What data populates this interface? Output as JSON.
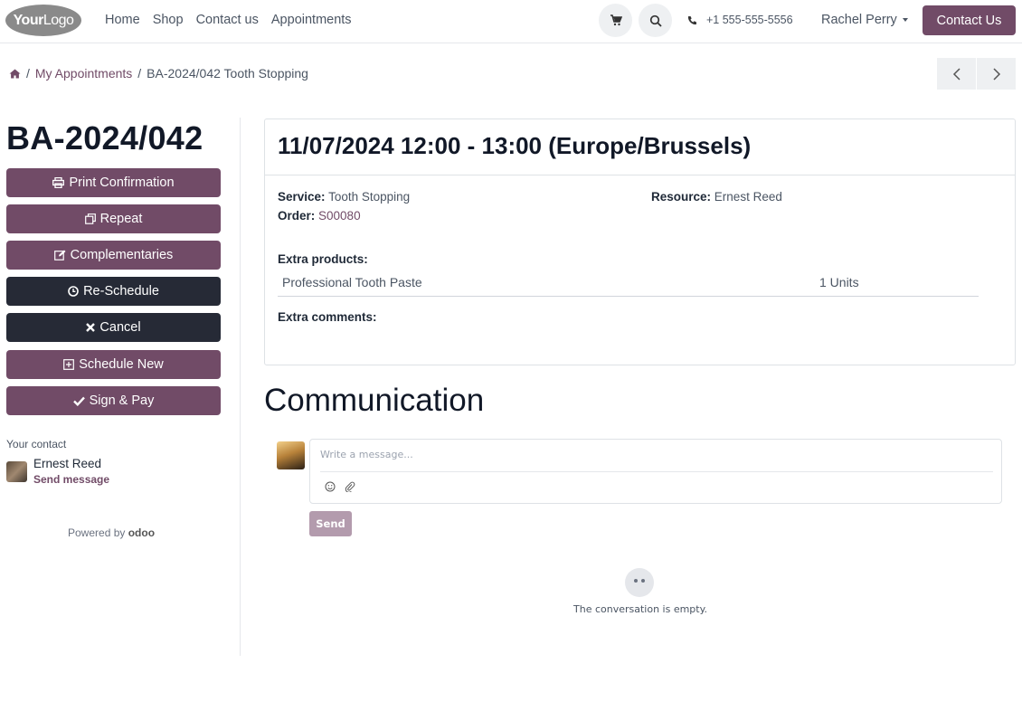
{
  "header": {
    "logo_text_bold": "Your",
    "logo_text_light": "Logo",
    "nav": [
      "Home",
      "Shop",
      "Contact us",
      "Appointments"
    ],
    "phone": "+1 555-555-5556",
    "user_name": "Rachel Perry",
    "contact_button": "Contact Us"
  },
  "breadcrumb": {
    "home_icon": "home-icon",
    "separator": "/",
    "items": [
      "My Appointments",
      "BA-2024/042 Tooth Stopping"
    ]
  },
  "sidebar": {
    "reference": "BA-2024/042",
    "buttons": [
      {
        "label": "Print Confirmation",
        "icon": "print-icon",
        "style": "purple"
      },
      {
        "label": "Repeat",
        "icon": "copy-icon",
        "style": "purple"
      },
      {
        "label": "Complementaries",
        "icon": "edit-icon",
        "style": "purple"
      },
      {
        "label": "Re-Schedule",
        "icon": "clock-icon",
        "style": "dark"
      },
      {
        "label": "Cancel",
        "icon": "x-icon",
        "style": "dark"
      },
      {
        "label": "Schedule New",
        "icon": "plus-square-icon",
        "style": "purple"
      },
      {
        "label": "Sign & Pay",
        "icon": "check-icon",
        "style": "purple"
      }
    ],
    "contact_label": "Your contact",
    "contact_name": "Ernest Reed",
    "send_message": "Send message",
    "powered_by": "Powered by",
    "powered_brand": "odoo"
  },
  "appointment": {
    "datetime": "11/07/2024 12:00 - 13:00 (Europe/Brussels)",
    "service_label": "Service:",
    "service_value": "Tooth Stopping",
    "resource_label": "Resource:",
    "resource_value": "Ernest Reed",
    "order_label": "Order:",
    "order_value": "S00080",
    "extra_products_label": "Extra products:",
    "products": [
      {
        "name": "Professional Tooth Paste",
        "qty": "1 Units"
      }
    ],
    "extra_comments_label": "Extra comments:"
  },
  "communication": {
    "title": "Communication",
    "placeholder": "Write a message...",
    "send_label": "Send",
    "empty_text": "The conversation is empty."
  },
  "colors": {
    "brand": "#714b67",
    "dark_button": "#262a36"
  }
}
